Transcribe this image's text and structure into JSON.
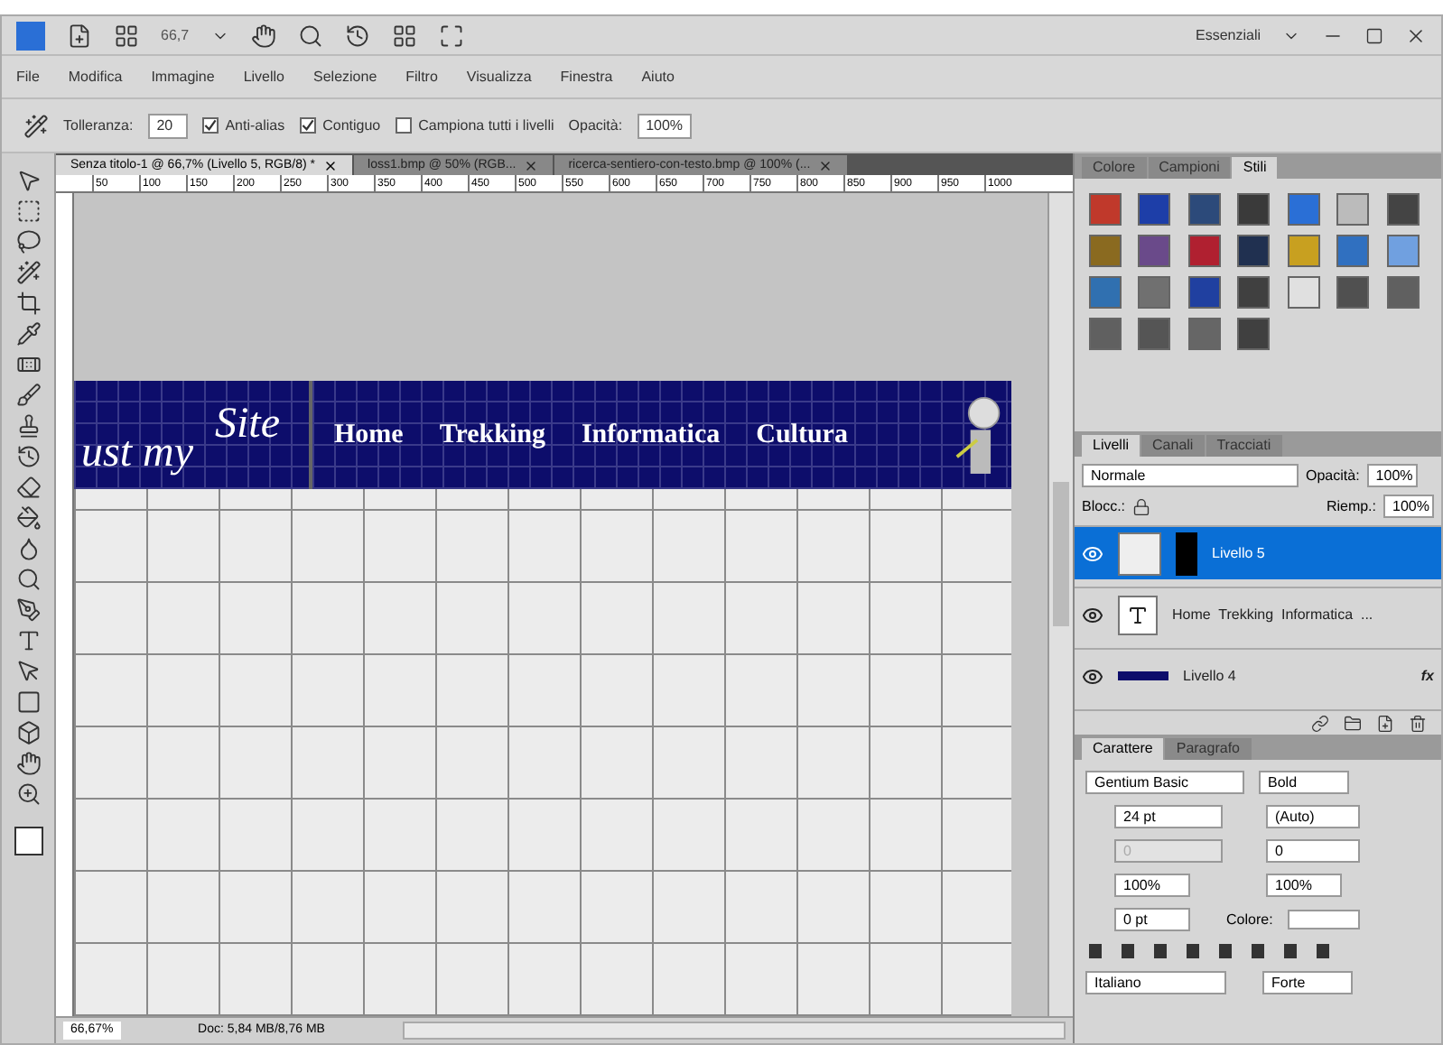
{
  "app_bar": {
    "zoom": "66,7",
    "workspace": "Essenziali"
  },
  "menu": [
    "File",
    "Modifica",
    "Immagine",
    "Livello",
    "Selezione",
    "Filtro",
    "Visualizza",
    "Finestra",
    "Aiuto"
  ],
  "options": {
    "tolerance_label": "Tolleranza:",
    "tolerance": "20",
    "checks": [
      {
        "label": "Anti-alias",
        "checked": true
      },
      {
        "label": "Contiguo",
        "checked": true
      },
      {
        "label": "Campiona tutti i livelli",
        "checked": false
      }
    ],
    "opacity_label": "Opacità:",
    "opacity": "100%"
  },
  "doc_tabs": [
    {
      "label": "Senza titolo-1 @ 66,7% (Livello 5, RGB/8) *",
      "selected": true
    },
    {
      "label": "loss1.bmp @ 50% (RGB...",
      "selected": false
    },
    {
      "label": "ricerca-sentiero-con-testo.bmp @ 100% (...",
      "selected": false
    }
  ],
  "ruler": [
    "50",
    "100",
    "150",
    "200",
    "250",
    "300",
    "350",
    "400",
    "450",
    "500",
    "550",
    "600",
    "650",
    "700",
    "750",
    "800",
    "850",
    "900",
    "950",
    "1000"
  ],
  "banner": {
    "logo_part": "ust my",
    "logo_word": "Site",
    "nav": [
      "Home",
      "Trekking",
      "Informatica",
      "Cultura"
    ]
  },
  "status": {
    "zoom": "66,67%",
    "doc": "Doc: 5,84 MB/8,76 MB"
  },
  "styles_panel": {
    "tabs": [
      {
        "label": "Colore",
        "selected": false
      },
      {
        "label": "Campioni",
        "selected": false
      },
      {
        "label": "Stili",
        "selected": true
      }
    ]
  },
  "layers_panel": {
    "tabs": [
      {
        "label": "Livelli",
        "selected": true
      },
      {
        "label": "Canali",
        "selected": false
      },
      {
        "label": "Tracciati",
        "selected": false
      }
    ],
    "blend": "Normale",
    "opacity_label": "Opacità:",
    "opacity": "100%",
    "lock_label": "Blocc.:",
    "fill_label": "Riemp.:",
    "fill": "100%",
    "layers": [
      {
        "kind": "mask",
        "name": "Livello 5",
        "selected": true
      },
      {
        "kind": "text",
        "name": "Home  Trekking  Informatica  ...",
        "selected": false
      },
      {
        "kind": "shape",
        "name": "Livello 4",
        "selected": false,
        "fx_label": "fx"
      }
    ]
  },
  "character_panel": {
    "tabs": [
      {
        "label": "Carattere",
        "selected": true
      },
      {
        "label": "Paragrafo",
        "selected": false
      }
    ],
    "font": "Gentium Basic",
    "style": "Bold",
    "size": "24 pt",
    "leading": "(Auto)",
    "kerning": "0",
    "kerning_disabled": true,
    "tracking": "0",
    "vscale": "100%",
    "hscale": "100%",
    "baseline": "0 pt",
    "color_label": "Colore:",
    "language": "Italiano",
    "antialias": "Forte"
  }
}
